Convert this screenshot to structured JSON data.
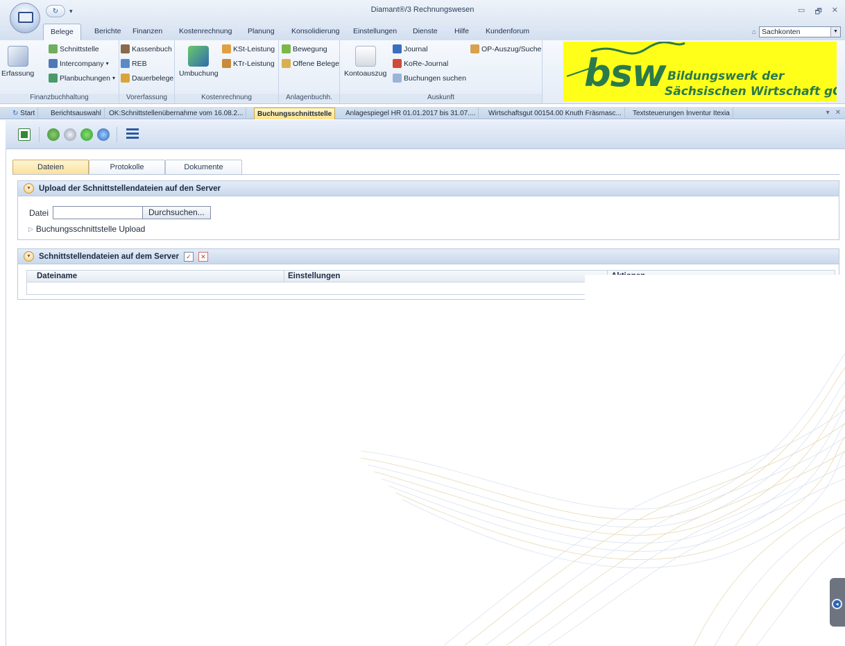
{
  "window": {
    "title": "Diamant®/3 Rechnungswesen",
    "controls": {
      "minimize": "▭",
      "restore": "🗗",
      "close": "✕"
    }
  },
  "ribbon": {
    "tabs": [
      "Belege",
      "Berichte",
      "Finanzen",
      "Kostenrechnung",
      "Planung",
      "Konsolidierung",
      "Einstellungen",
      "Dienste",
      "Hilfe",
      "Kundenforum"
    ],
    "active_tab": "Belege",
    "search_value": "Sachkonten",
    "groups": {
      "finanzbuchhaltung": {
        "label": "Finanzbuchhaltung",
        "big": "Erfassung",
        "items": [
          "Schnittstelle",
          "Intercompany",
          "Planbuchungen"
        ]
      },
      "vorerfassung": {
        "label": "Vorerfassung",
        "items": [
          "Kassenbuch",
          "REB",
          "Dauerbelege"
        ]
      },
      "kostenrechnung": {
        "label": "Kostenrechnung",
        "big": "Umbuchung",
        "items": [
          "KSt-Leistung",
          "KTr-Leistung"
        ]
      },
      "anlagenbuchh": {
        "label": "Anlagenbuchh.",
        "items": [
          "Bewegung",
          "Offene Belege"
        ]
      },
      "auskunft": {
        "label": "Auskunft",
        "big": "Kontoauszug",
        "items": [
          "Journal",
          "KoRe-Journal",
          "Buchungen suchen",
          "OP-Auszug/Suche"
        ]
      }
    }
  },
  "logo": {
    "mark": "bsw",
    "line1": "Bildungswerk der",
    "line2": "Sächsischen Wirtschaft gGmbH",
    "bg_color": "#ffff1a",
    "text_color": "#2b7a4b"
  },
  "doc_tabs": [
    "Start",
    "Berichtsauswahl",
    "OK:Schnittstellenübernahme vom 16.08.2...",
    "Buchungsschnittstelle",
    "Anlagespiegel HR 01.01.2017 bis 31.07....",
    "Wirtschaftsgut 00154.00 Knuth Fräsmasc...",
    "Textsteuerungen",
    "Inventur Itexia"
  ],
  "doc_tab_controls": {
    "menu": "▾",
    "close": "✕"
  },
  "content_tabs": [
    "Dateien",
    "Protokolle",
    "Dokumente"
  ],
  "upload_panel": {
    "title": "Upload der Schnittstellendateien auf den Server",
    "file_label": "Datei",
    "browse_label": "Durchsuchen...",
    "link_label": "Buchungsschnittstelle Upload"
  },
  "server_panel": {
    "title": "Schnittstellendateien auf dem Server",
    "columns": [
      "Dateiname",
      "Einstellungen",
      "Aktionen"
    ]
  }
}
